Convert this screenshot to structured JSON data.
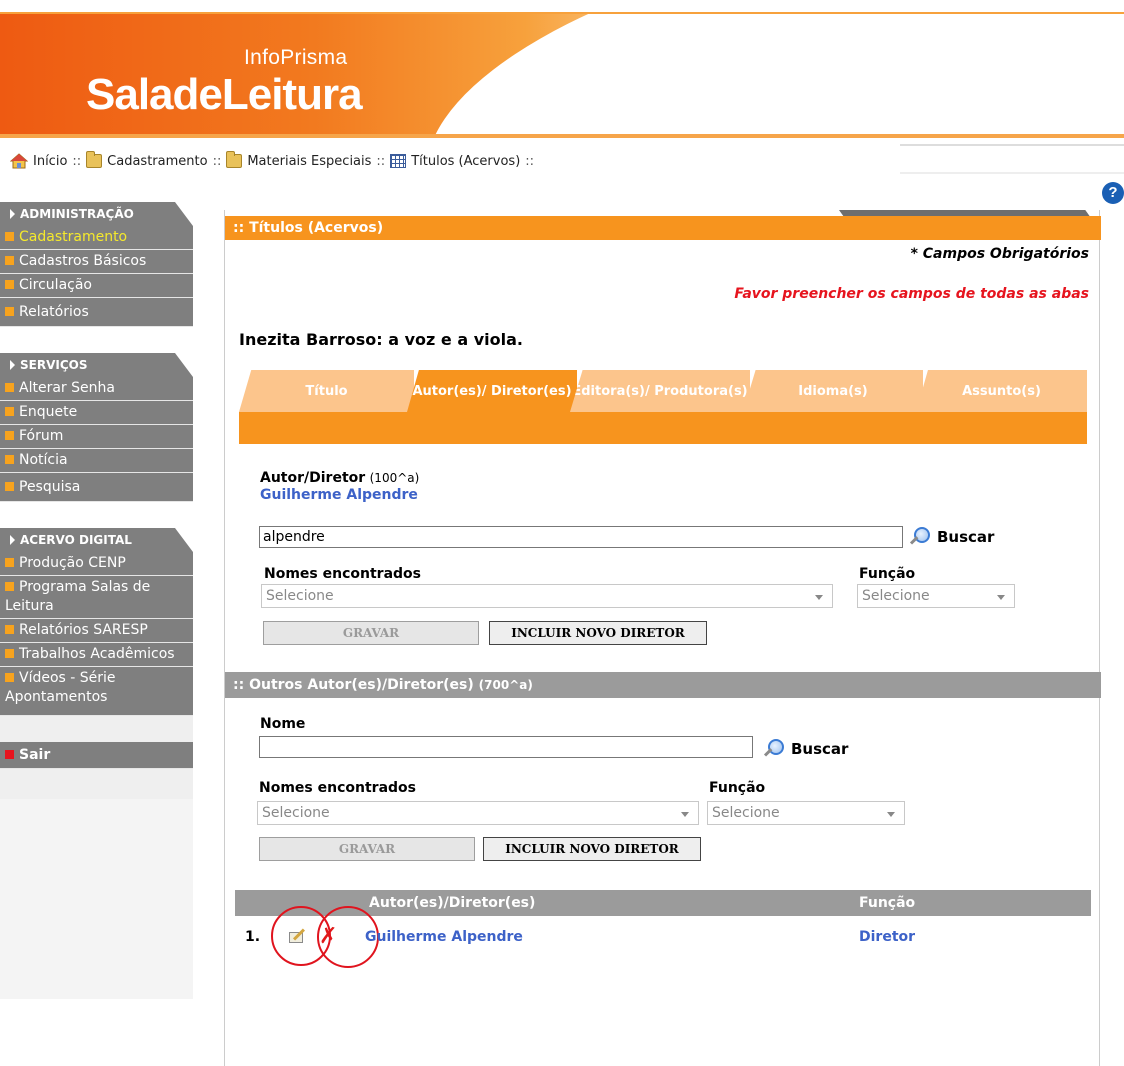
{
  "header": {
    "brand_small": "InfoPrisma",
    "brand_big": "SaladeLeitura"
  },
  "breadcrumb": [
    {
      "label": "Início",
      "icon": "home-icon"
    },
    {
      "label": "Cadastramento",
      "icon": "folder-icon"
    },
    {
      "label": "Materiais Especiais",
      "icon": "folder-icon"
    },
    {
      "label": "Títulos (Acervos)",
      "icon": "grid-icon"
    }
  ],
  "breadcrumb_sep": "::",
  "help": {
    "glyph": "?"
  },
  "sidebar": {
    "admin": {
      "title": "ADMINISTRAÇÃO",
      "items": [
        "Cadastramento",
        "Cadastros Básicos",
        "Circulação",
        "Relatórios"
      ]
    },
    "servicos": {
      "title": "SERVIÇOS",
      "items": [
        "Alterar Senha",
        "Enquete",
        "Fórum",
        "Notícia",
        "Pesquisa"
      ]
    },
    "acervo": {
      "title": "ACERVO DIGITAL",
      "items": [
        "Produção CENP",
        "Programa Salas de Leitura",
        "Relatórios SARESP",
        "Trabalhos Acadêmicos",
        "Vídeos - Série Apontamentos"
      ]
    },
    "sair": "Sair"
  },
  "panel": {
    "title": ":: Títulos (Acervos)",
    "required_note": "* Campos Obrigatórios",
    "warning": "Favor preencher os campos de todas as abas",
    "work_title": "Inezita Barroso: a voz e a viola."
  },
  "tabs": [
    {
      "label": "Título"
    },
    {
      "label": "Autor(es)/ Diretor(es)"
    },
    {
      "label": "Editora(s)/ Produtora(s)"
    },
    {
      "label": "Idioma(s)"
    },
    {
      "label": "Assunto(s)"
    }
  ],
  "author": {
    "label": "Autor/Diretor",
    "field_code": "(100^a)",
    "current_name": "Guilherme Alpendre",
    "search_value": "alpendre",
    "search_label": "Buscar",
    "names_found_label": "Nomes encontrados",
    "names_placeholder": "Selecione",
    "function_label": "Função",
    "function_placeholder": "Selecione",
    "save_label": "GRAVAR",
    "new_director_label": "INCLUIR NOVO DIRETOR"
  },
  "others": {
    "title": ":: Outros Autor(es)/Diretor(es)",
    "field_code": "(700^a)",
    "name_label": "Nome",
    "name_value": "",
    "search_label": "Buscar",
    "names_found_label": "Nomes encontrados",
    "names_placeholder": "Selecione",
    "function_label": "Função",
    "function_placeholder": "Selecione",
    "save_label": "GRAVAR",
    "new_director_label": "INCLUIR NOVO DIRETOR"
  },
  "list": {
    "col_author": "Autor(es)/Diretor(es)",
    "col_function": "Função",
    "rows": [
      {
        "num": "1.",
        "name": "Guilherme Alpendre",
        "function": "Diretor"
      }
    ]
  },
  "colors": {
    "accent": "#f7941e",
    "sidebar_bg": "#7f7f7f",
    "link": "#3d62c8",
    "warning": "#e6141e",
    "active_item": "#f5e92c"
  }
}
